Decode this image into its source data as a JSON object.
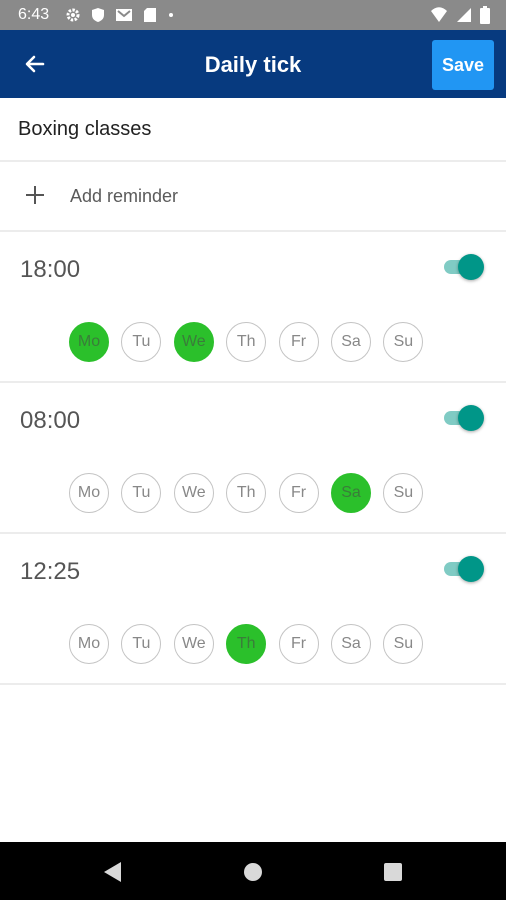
{
  "status_bar": {
    "time": "6:43",
    "icons": [
      "gear-icon",
      "shield-icon",
      "gmail-icon",
      "sd-card-icon",
      "dot-icon",
      "wifi-icon",
      "signal-icon",
      "battery-icon"
    ]
  },
  "app_bar": {
    "title": "Daily tick",
    "save_label": "Save",
    "colors": {
      "background": "#073a7f",
      "save": "#2196f3"
    }
  },
  "title_field": {
    "value": "Boxing classes"
  },
  "add_reminder": {
    "label": "Add reminder"
  },
  "day_labels": [
    "Mo",
    "Tu",
    "We",
    "Th",
    "Fr",
    "Sa",
    "Su"
  ],
  "reminders": [
    {
      "time": "18:00",
      "enabled": true,
      "days": [
        true,
        false,
        true,
        false,
        false,
        false,
        false
      ]
    },
    {
      "time": "08:00",
      "enabled": true,
      "days": [
        false,
        false,
        false,
        false,
        false,
        true,
        false
      ]
    },
    {
      "time": "12:25",
      "enabled": true,
      "days": [
        false,
        false,
        false,
        true,
        false,
        false,
        false
      ]
    }
  ],
  "colors": {
    "day_selected": "#2bc02b",
    "toggle_on": "#009688"
  }
}
